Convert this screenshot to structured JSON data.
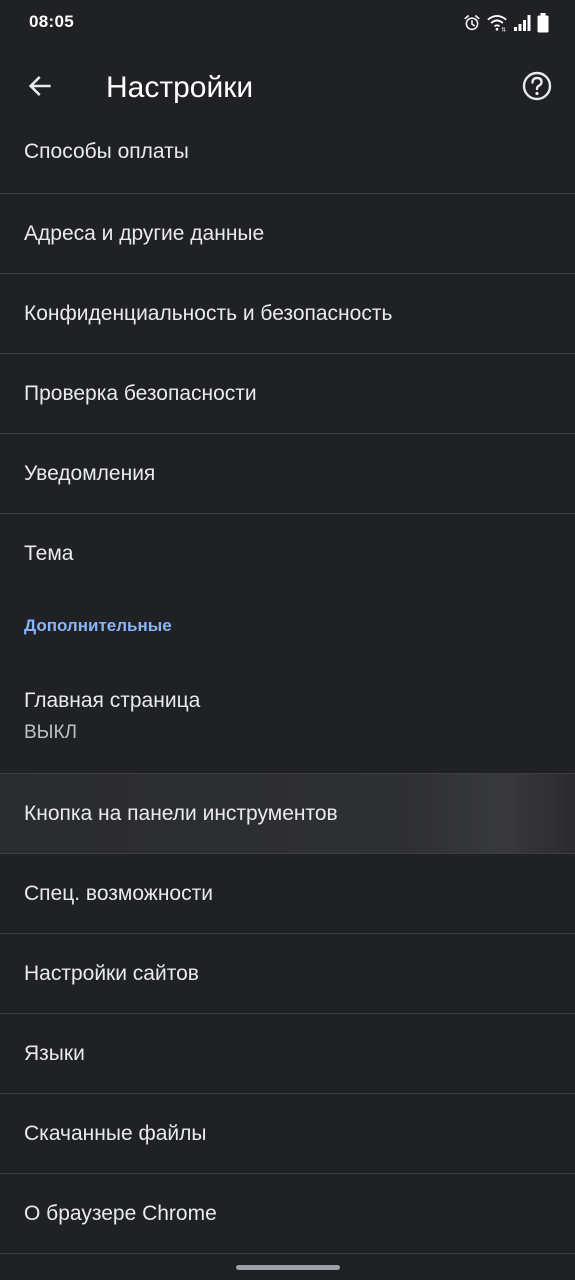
{
  "status_bar": {
    "time": "08:05",
    "icons": [
      "alarm-icon",
      "wifi-icon",
      "signal-icon",
      "battery-icon"
    ]
  },
  "app_bar": {
    "title": "Настройки",
    "back_icon": "arrow-left-icon",
    "help_icon": "help-circle-icon"
  },
  "settings": {
    "items_basic": [
      {
        "label": "Способы оплаты"
      },
      {
        "label": "Адреса и другие данные"
      },
      {
        "label": "Конфиденциальность и безопасность"
      },
      {
        "label": "Проверка безопасности"
      },
      {
        "label": "Уведомления"
      },
      {
        "label": "Тема"
      }
    ],
    "advanced_header": "Дополнительные",
    "homepage": {
      "label": "Главная страница",
      "value": "ВЫКЛ"
    },
    "items_advanced": [
      {
        "label": "Кнопка на панели инструментов"
      },
      {
        "label": "Спец. возможности"
      },
      {
        "label": "Настройки сайтов"
      },
      {
        "label": "Языки"
      },
      {
        "label": "Скачанные файлы"
      },
      {
        "label": "О браузере Chrome"
      }
    ]
  },
  "colors": {
    "background": "#202124",
    "text": "#e8eaed",
    "accent": "#8ab4f8",
    "divider": "#3c3d40"
  }
}
